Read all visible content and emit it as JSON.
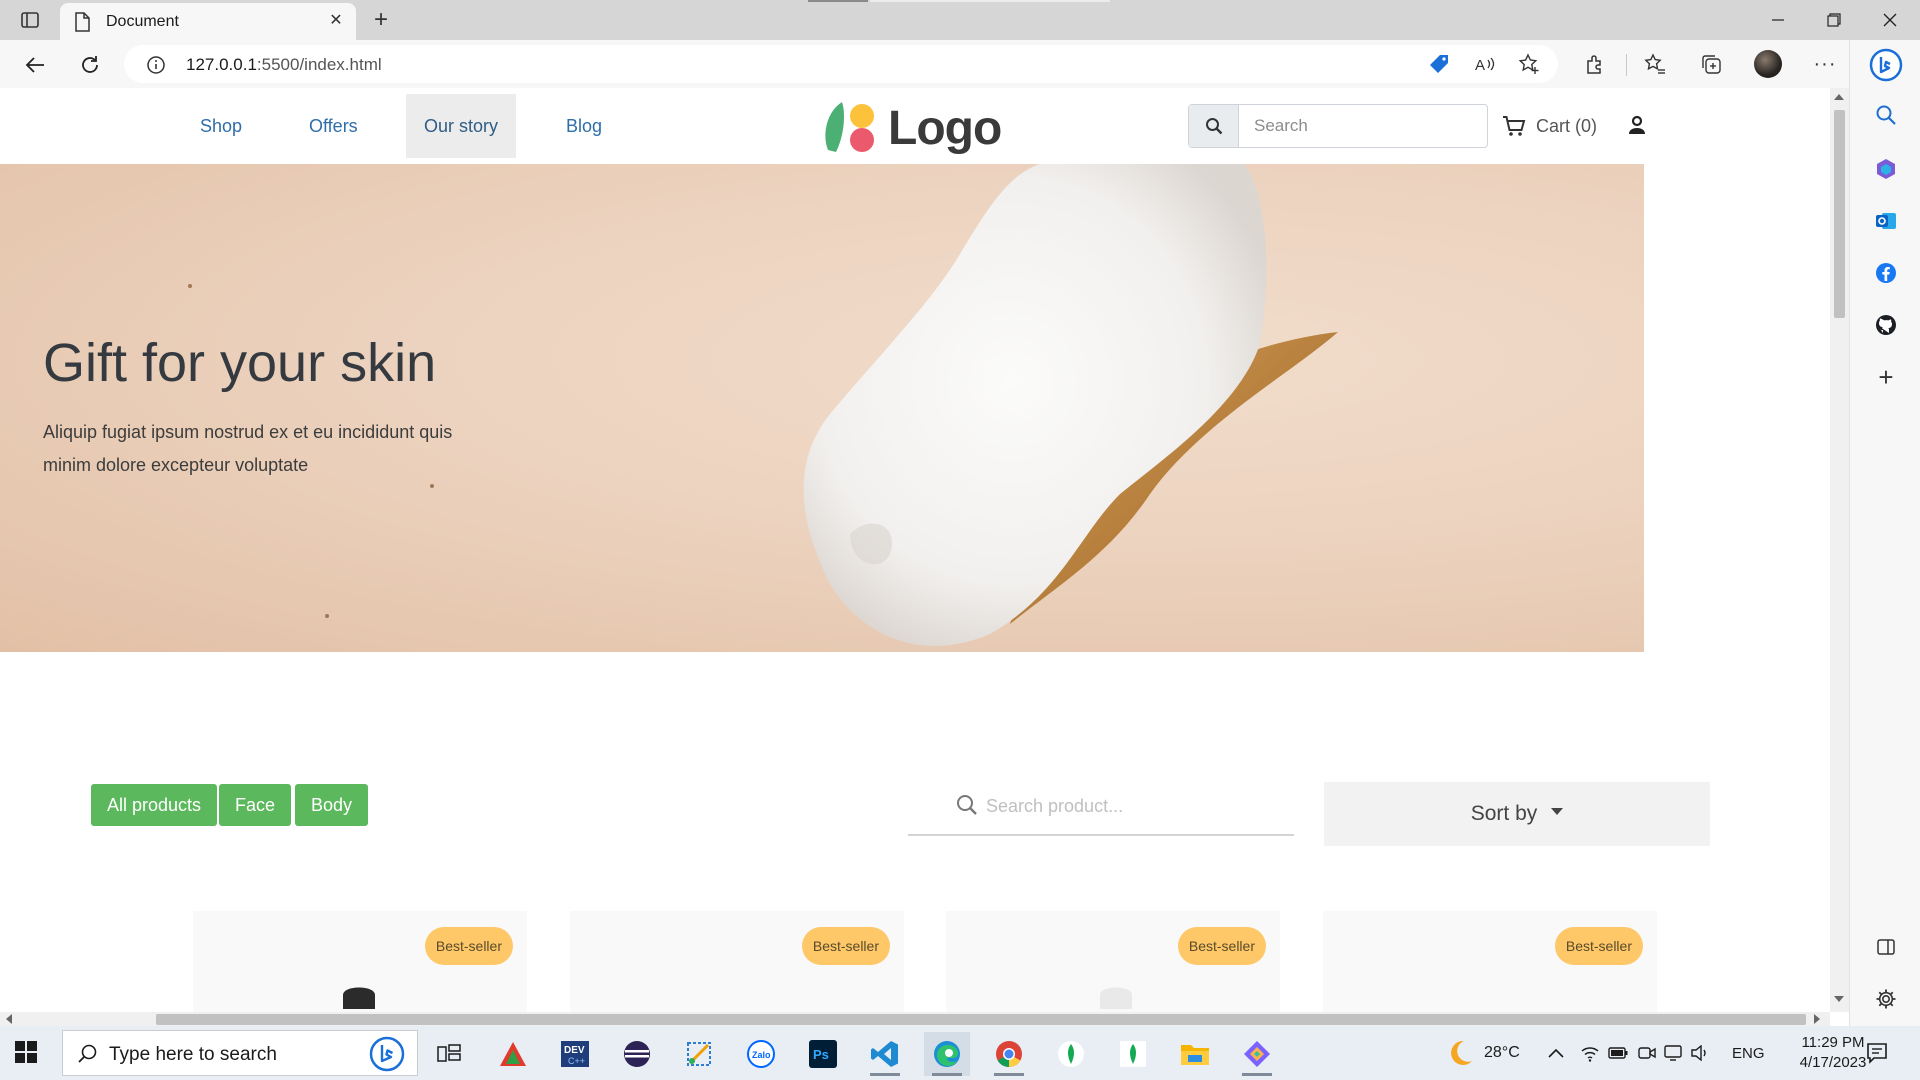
{
  "browser": {
    "tab_title": "Document",
    "url_host": "127.0.0.1",
    "url_path": ":5500/index.html"
  },
  "site": {
    "nav": [
      "Shop",
      "Offers",
      "Our story",
      "Blog"
    ],
    "active_nav": "Our story",
    "logo_text": "Logo",
    "search_placeholder": "Search",
    "cart_label": "Cart (0)"
  },
  "hero": {
    "title": "Gift for your skin",
    "subtitle": "Aliquip fugiat ipsum nostrud ex et eu incididunt quis minim dolore excepteur voluptate"
  },
  "filters": {
    "buttons": [
      "All products",
      "Face",
      "Body"
    ],
    "search_placeholder": "Search product...",
    "sort_label": "Sort by"
  },
  "products": [
    {
      "badge": "Best-seller"
    },
    {
      "badge": "Best-seller"
    },
    {
      "badge": "Best-seller"
    },
    {
      "badge": "Best-seller"
    }
  ],
  "taskbar": {
    "search_placeholder": "Type here to search",
    "weather": "28°C",
    "language": "ENG",
    "time": "11:29 PM",
    "date": "4/17/2023"
  },
  "colors": {
    "accent_green": "#5cb85c",
    "badge_yellow": "#fec868",
    "nav_blue": "#2f6ea9"
  }
}
